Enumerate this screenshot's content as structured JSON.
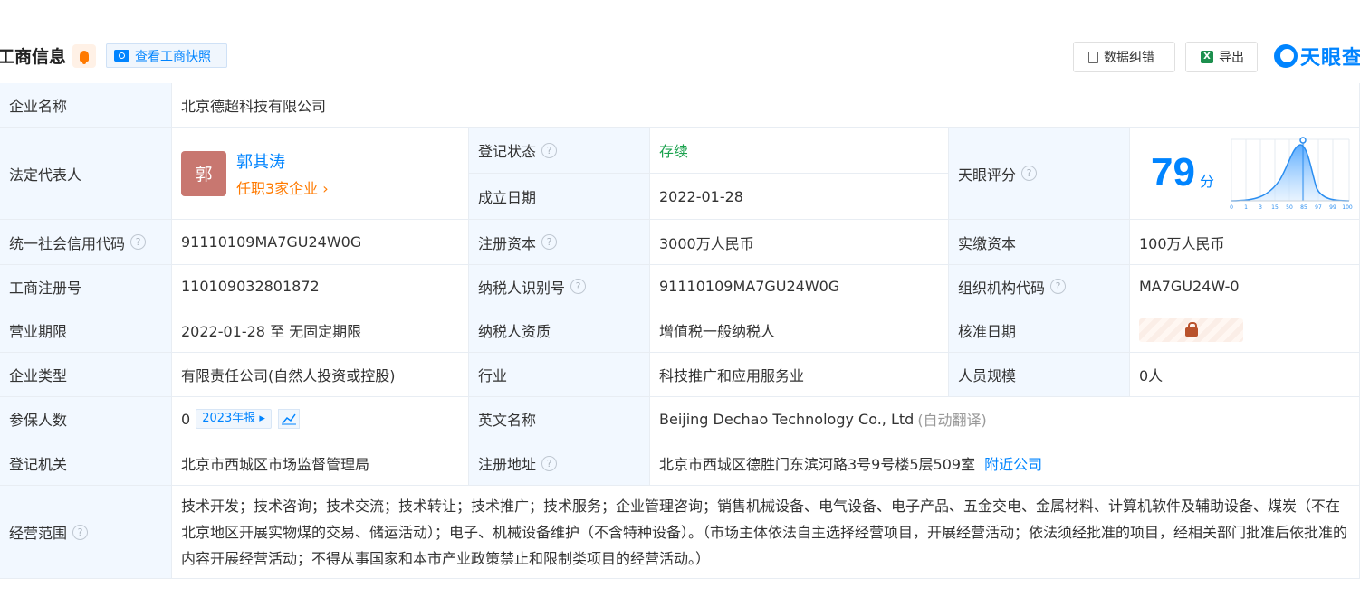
{
  "header": {
    "title": "工商信息",
    "snapshot_label": "查看工商快照",
    "fix_label": "数据纠错",
    "export_label": "导出",
    "logo_text": "天眼查"
  },
  "rows": {
    "company_name": {
      "label": "企业名称",
      "value": "北京德超科技有限公司"
    },
    "legal_rep": {
      "label": "法定代表人",
      "avatar": "郭",
      "name": "郭其涛",
      "jobs": "任职3家企业"
    },
    "reg_status": {
      "label": "登记状态",
      "value": "存续"
    },
    "found_date": {
      "label": "成立日期",
      "value": "2022-01-28"
    },
    "score": {
      "label": "天眼评分",
      "value": "79",
      "unit": "分",
      "axis": [
        "0",
        "1",
        "3",
        "15",
        "50",
        "85",
        "97",
        "99",
        "100"
      ]
    },
    "credit_code": {
      "label": "统一社会信用代码",
      "value": "91110109MA7GU24W0G"
    },
    "reg_capital": {
      "label": "注册资本",
      "value": "3000万人民币"
    },
    "paid_capital": {
      "label": "实缴资本",
      "value": "100万人民币"
    },
    "reg_no": {
      "label": "工商注册号",
      "value": "110109032801872"
    },
    "tax_id": {
      "label": "纳税人识别号",
      "value": "91110109MA7GU24W0G"
    },
    "org_code": {
      "label": "组织机构代码",
      "value": "MA7GU24W-0"
    },
    "term": {
      "label": "营业期限",
      "value": "2022-01-28 至 无固定期限"
    },
    "tax_quality": {
      "label": "纳税人资质",
      "value": "增值税一般纳税人"
    },
    "approve_date": {
      "label": "核准日期"
    },
    "company_type": {
      "label": "企业类型",
      "value": "有限责任公司(自然人投资或控股)"
    },
    "industry": {
      "label": "行业",
      "value": "科技推广和应用服务业"
    },
    "staff_size": {
      "label": "人员规模",
      "value": "0人"
    },
    "insured": {
      "label": "参保人数",
      "value": "0",
      "report_tag": "2023年报"
    },
    "english_name": {
      "label": "英文名称",
      "value": "Beijing Dechao Technology Co., Ltd",
      "note": "(自动翻译)"
    },
    "authority": {
      "label": "登记机关",
      "value": "北京市西城区市场监督管理局"
    },
    "address": {
      "label": "注册地址",
      "value": "北京市西城区德胜门东滨河路3号9号楼5层509室",
      "nearby": "附近公司"
    },
    "scope": {
      "label": "经营范围",
      "value": "技术开发；技术咨询；技术交流；技术转让；技术推广；技术服务；企业管理咨询；销售机械设备、电气设备、电子产品、五金交电、金属材料、计算机软件及辅助设备、煤炭（不在北京地区开展实物煤的交易、储运活动）；电子、机械设备维护（不含特种设备）。（市场主体依法自主选择经营项目，开展经营活动；依法须经批准的项目，经相关部门批准后依批准的内容开展经营活动；不得从事国家和本市产业政策禁止和限制类项目的经营活动。）"
    }
  },
  "colors": {
    "accent": "#0084ff",
    "label_bg": "#f2f8ff",
    "status_green": "#1ba24e",
    "orange": "#ff7a00"
  }
}
